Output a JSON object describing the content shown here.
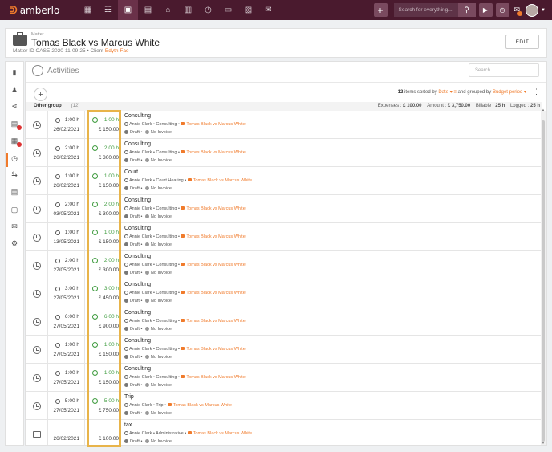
{
  "app": {
    "logo_text": "amberlo",
    "logo_mark": "ᕲ"
  },
  "topbar": {
    "nav_icons": [
      "dashboard-icon",
      "contacts-icon",
      "matters-icon",
      "documents-icon",
      "billing-icon",
      "calendar-icon",
      "time-icon",
      "folder-icon",
      "reports-icon",
      "mail-icon"
    ],
    "active_icon_index": 2,
    "search_placeholder": "Search for everything...",
    "add_label": "+"
  },
  "matter": {
    "label": "Matter",
    "title": "Tomas Black vs Marcus White",
    "id_label": "Matter ID",
    "id": "CASE-2020-11-09-25",
    "client_label": "Client",
    "client": "Edyth Fae",
    "edit_label": "EDIT"
  },
  "activities": {
    "title": "Activities",
    "search_placeholder": "Search",
    "count": "12",
    "sort_text": "items sorted by",
    "sort_field": "Date",
    "group_text": "and grouped by",
    "group_field": "Budget period"
  },
  "group": {
    "name": "Other group",
    "count": "(12)",
    "expenses_label": "Expenses :",
    "expenses": "£ 100.00",
    "amount_label": "Amount :",
    "amount": "£ 3,750.00",
    "billable_label": "Billable :",
    "billable": "25 h",
    "logged_label": "Logged :",
    "logged": "25 h"
  },
  "rows": [
    {
      "type": "time",
      "dur": "1:00 h",
      "date": "26/02/2021",
      "bill": "1:00 h",
      "amount": "£ 150.00",
      "title": "Consulting",
      "user": "Annie Clark",
      "kind": "Consulting",
      "matter": "Tomas Black vs Marcus White",
      "status": "Draft",
      "invoice": "No Invoice"
    },
    {
      "type": "time",
      "dur": "2:00 h",
      "date": "26/02/2021",
      "bill": "2:00 h",
      "amount": "£ 300.00",
      "title": "Consulting",
      "user": "Annie Clark",
      "kind": "Consulting",
      "matter": "Tomas Black vs Marcus White",
      "status": "Draft",
      "invoice": "No Invoice"
    },
    {
      "type": "time",
      "dur": "1:00 h",
      "date": "26/02/2021",
      "bill": "1:00 h",
      "amount": "£ 150.00",
      "title": "Court",
      "user": "Annie Clark",
      "kind": "Court Hearing",
      "matter": "Tomas Black vs Marcus White",
      "status": "Draft",
      "invoice": "No Invoice"
    },
    {
      "type": "time",
      "dur": "2:00 h",
      "date": "03/05/2021",
      "bill": "2:00 h",
      "amount": "£ 300.00",
      "title": "Consulting",
      "user": "Annie Clark",
      "kind": "Consulting",
      "matter": "Tomas Black vs Marcus White",
      "status": "Draft",
      "invoice": "No Invoice"
    },
    {
      "type": "time",
      "dur": "1:00 h",
      "date": "13/05/2021",
      "bill": "1:00 h",
      "amount": "£ 150.00",
      "title": "Consulting",
      "user": "Annie Clark",
      "kind": "Consulting",
      "matter": "Tomas Black vs Marcus White",
      "status": "Draft",
      "invoice": "No Invoice"
    },
    {
      "type": "time",
      "dur": "2:00 h",
      "date": "27/05/2021",
      "bill": "2:00 h",
      "amount": "£ 300.00",
      "title": "Consulting",
      "user": "Annie Clark",
      "kind": "Consulting",
      "matter": "Tomas Black vs Marcus White",
      "status": "Draft",
      "invoice": "No Invoice"
    },
    {
      "type": "time",
      "dur": "3:00 h",
      "date": "27/05/2021",
      "bill": "3:00 h",
      "amount": "£ 450.00",
      "title": "Consulting",
      "user": "Annie Clark",
      "kind": "Consulting",
      "matter": "Tomas Black vs Marcus White",
      "status": "Draft",
      "invoice": "No Invoice"
    },
    {
      "type": "time",
      "dur": "6:00 h",
      "date": "27/05/2021",
      "bill": "6:00 h",
      "amount": "£ 900.00",
      "title": "Consulting",
      "user": "Annie Clark",
      "kind": "Consulting",
      "matter": "Tomas Black vs Marcus White",
      "status": "Draft",
      "invoice": "No Invoice"
    },
    {
      "type": "time",
      "dur": "1:00 h",
      "date": "27/05/2021",
      "bill": "1:00 h",
      "amount": "£ 150.00",
      "title": "Consulting",
      "user": "Annie Clark",
      "kind": "Consulting",
      "matter": "Tomas Black vs Marcus White",
      "status": "Draft",
      "invoice": "No Invoice"
    },
    {
      "type": "time",
      "dur": "1:00 h",
      "date": "27/05/2021",
      "bill": "1:00 h",
      "amount": "£ 150.00",
      "title": "Consulting",
      "user": "Annie Clark",
      "kind": "Consulting",
      "matter": "Tomas Black vs Marcus White",
      "status": "Draft",
      "invoice": "No Invoice"
    },
    {
      "type": "time",
      "dur": "5:00 h",
      "date": "27/05/2021",
      "bill": "5:00 h",
      "amount": "£ 750.00",
      "title": "Trip",
      "user": "Annie Clark",
      "kind": "Trip",
      "matter": "Tomas Black vs Marcus White",
      "status": "Draft",
      "invoice": "No Invoice"
    },
    {
      "type": "expense",
      "dur": "",
      "date": "26/02/2021",
      "bill": "",
      "amount": "£ 100.00",
      "title": "tax",
      "user": "Annie Clark",
      "kind": "Administrative",
      "matter": "Tomas Black vs Marcus White",
      "status": "Draft",
      "invoice": "No Invoice"
    }
  ],
  "colors": {
    "accent": "#f07b2c",
    "topbar": "#4a1a2e",
    "billable": "#3c9a3c",
    "highlight": "#e8b44a"
  }
}
